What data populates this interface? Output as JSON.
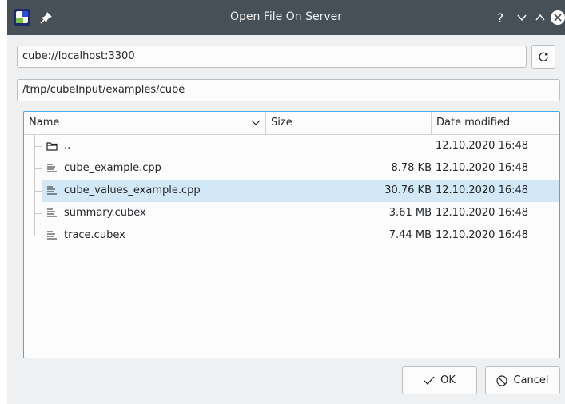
{
  "window": {
    "title": "Open File On Server"
  },
  "titlebar_buttons": [
    "help-icon",
    "minimize-icon",
    "maximize-icon",
    "close-icon"
  ],
  "server": {
    "url": "cube://localhost:3300"
  },
  "path": {
    "value": "/tmp/cubeInput/examples/cube"
  },
  "columns": {
    "name": "Name",
    "size": "Size",
    "date": "Date modified"
  },
  "files": [
    {
      "name": "..",
      "size": "",
      "date": "12.10.2020 16:48",
      "icon": "folder-icon",
      "editing": true
    },
    {
      "name": "cube_example.cpp",
      "size": "8.78 KB",
      "date": "12.10.2020 16:48",
      "icon": "text-file-icon"
    },
    {
      "name": "cube_values_example.cpp",
      "size": "30.76 KB",
      "date": "12.10.2020 16:48",
      "icon": "text-file-icon",
      "selected": true
    },
    {
      "name": "summary.cubex",
      "size": "3.61 MB",
      "date": "12.10.2020 16:48",
      "icon": "text-file-icon"
    },
    {
      "name": "trace.cubex",
      "size": "7.44 MB",
      "date": "12.10.2020 16:48",
      "icon": "text-file-icon"
    }
  ],
  "buttons": {
    "ok": "OK",
    "cancel": "Cancel"
  },
  "colors": {
    "titlebar": "#475057",
    "accent": "#3daee9",
    "selection": "#d3e8f7",
    "background": "#eff0f1"
  }
}
